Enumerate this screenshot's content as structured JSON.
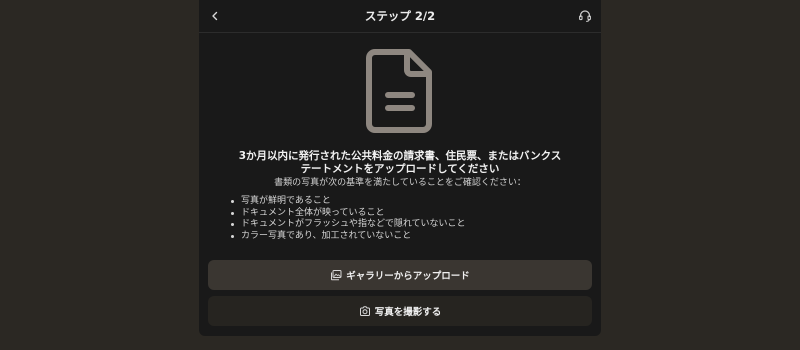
{
  "header": {
    "title": "ステップ 2/2",
    "back_icon": "chevron-left-icon",
    "support_icon": "headset-icon"
  },
  "illustration": {
    "icon": "document-icon",
    "color": "#8e8780"
  },
  "instructions": {
    "title_line1": "3か月以内に発行された公共料金の請求書、住民票、またはバンクス",
    "title_line2": "テートメントをアップロードしてください",
    "subtitle": "書類の写真が次の基準を満たしていることをご確認ください：",
    "criteria": [
      "写真が鮮明であること",
      "ドキュメント全体が映っていること",
      "ドキュメントがフラッシュや指などで隠れていないこと",
      "カラー写真であり、加工されていないこと"
    ]
  },
  "actions": {
    "upload_gallery_label": "ギャラリーからアップロード",
    "upload_gallery_icon": "gallery-icon",
    "take_photo_label": "写真を撮影する",
    "take_photo_icon": "camera-icon"
  },
  "colors": {
    "background": "#2b2823",
    "modal": "#191919",
    "primary_button": "#3a3631",
    "secondary_button": "#262420"
  }
}
